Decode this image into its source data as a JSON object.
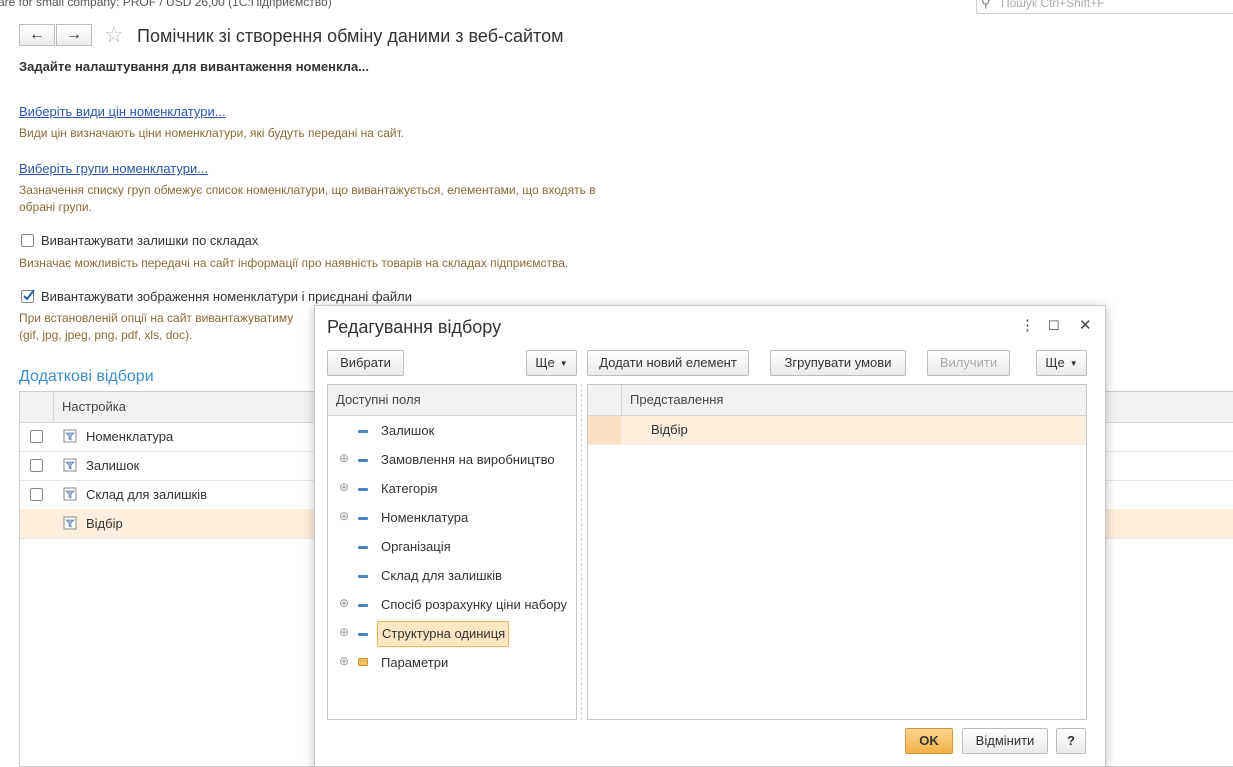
{
  "window": {
    "top_text": "are for small company: PROF / USD 26,00  (1С:Підприємство)",
    "search_placeholder": "Пошук Ctrl+Shift+F"
  },
  "page": {
    "title": "Помічник зі створення обміну даними з веб-сайтом",
    "subtitle": "Задайте налаштування для вивантаження номенкла...",
    "price_types_link": "Виберіть види цін номенклатури...",
    "price_types_hint": "Види цін визначають ціни номенклатури, які будуть передані на сайт.",
    "groups_link": "Виберіть групи номенклатури...",
    "groups_hint_line1": "Зазначення списку груп обмежує список номенклатури, що вивантажується, елементами, що входять в",
    "groups_hint_line2": "обрані групи.",
    "stock_checkbox": {
      "label": "Вивантажувати залишки по складах",
      "checked": false
    },
    "stock_hint": "Визначає можливість передачі на сайт інформації про наявність товарів на складах підприємства.",
    "images_checkbox": {
      "label": "Вивантажувати зображення номенклатури і приєднані файли",
      "checked": true
    },
    "images_hint_line1": "При встановленій опції на сайт вивантажуватиму",
    "images_hint_line2": "(gif, jpg, jpeg, png, pdf, xls, doc).",
    "additional_filters_title": "Додаткові відбори",
    "filters_table": {
      "header": "Настройка",
      "rows": [
        {
          "label": "Номенклатура",
          "checkbox": true,
          "selected": false
        },
        {
          "label": "Залишок",
          "checkbox": true,
          "selected": false
        },
        {
          "label": "Склад для залишків",
          "checkbox": true,
          "selected": false
        },
        {
          "label": "Відбір",
          "checkbox": false,
          "selected": true
        }
      ]
    }
  },
  "dialog": {
    "title": "Редагування відбору",
    "menu_glyph": "⋮",
    "maximize_glyph": "☐",
    "close_glyph": "✕",
    "select_button": "Вибрати",
    "more_button_left": "Ще",
    "add_button": "Додати новий елемент",
    "group_button": "Згрупувати умови",
    "exclude_button": "Вилучити",
    "more_button_right": "Ще",
    "available_fields_header": "Доступні поля",
    "fields": [
      {
        "label": "Залишок",
        "expandable": false,
        "icon": "field-icon"
      },
      {
        "label": "Замовлення на виробництво",
        "expandable": true,
        "icon": "field-icon"
      },
      {
        "label": "Категорія",
        "expandable": true,
        "icon": "field-icon"
      },
      {
        "label": "Номенклатура",
        "expandable": true,
        "icon": "field-icon"
      },
      {
        "label": "Організація",
        "expandable": false,
        "icon": "field-icon"
      },
      {
        "label": "Склад для залишків",
        "expandable": false,
        "icon": "field-icon"
      },
      {
        "label": "Спосіб розрахунку ціни набору",
        "expandable": true,
        "icon": "field-icon"
      },
      {
        "label": "Структурна одиниця",
        "expandable": true,
        "icon": "field-icon",
        "selected": true
      },
      {
        "label": "Параметри",
        "expandable": true,
        "icon": "folder-icon"
      }
    ],
    "representation_header": "Представлення",
    "representation_row": "Відбір",
    "ok_button": "OK",
    "cancel_button": "Відмінити",
    "help_button": "?"
  }
}
